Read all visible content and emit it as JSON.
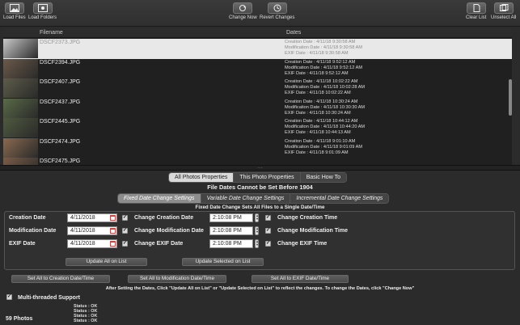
{
  "toolbar": {
    "load_files": "Load Files",
    "load_folders": "Load Folders",
    "change_now": "Change Now",
    "revert_changes": "Revert Changes",
    "clear_list": "Clear List",
    "unselect_all": "Unselect All"
  },
  "table": {
    "col_filename": "Filename",
    "col_dates": "Dates",
    "rows": [
      {
        "filename": "DSCF2373.JPG",
        "creation": "Creation Date : 4/11/18 9:30:58 AM",
        "modification": "Modification Date : 4/11/18 9:30:58 AM",
        "exif": "EXIF Date : 4/11/18 9:30:58 AM",
        "selected": true
      },
      {
        "filename": "DSCF2394.JPG",
        "creation": "Creation Date : 4/11/18 9:52:12 AM",
        "modification": "Modification Date : 4/11/18 9:52:12 AM",
        "exif": "EXIF Date : 4/11/18 9:52:12 AM",
        "selected": false
      },
      {
        "filename": "DSCF2407.JPG",
        "creation": "Creation Date : 4/11/18 10:02:22 AM",
        "modification": "Modification Date : 4/11/18 10:02:28 AM",
        "exif": "EXIF Date : 4/11/18 10:02:22 AM",
        "selected": false
      },
      {
        "filename": "DSCF2437.JPG",
        "creation": "Creation Date : 4/11/18 10:30:24 AM",
        "modification": "Modification Date : 4/11/18 10:30:30 AM",
        "exif": "EXIF Date : 4/11/18 10:30:24 AM",
        "selected": false
      },
      {
        "filename": "DSCF2445.JPG",
        "creation": "Creation Date : 4/11/18 10:44:12 AM",
        "modification": "Modification Date : 4/11/18 10:44:20 AM",
        "exif": "EXIF Date : 4/11/18 10:44:13 AM",
        "selected": false
      },
      {
        "filename": "DSCF2474.JPG",
        "creation": "Creation Date : 4/11/18 9:01:10 AM",
        "modification": "Modification Date : 4/11/18 9:01:09 AM",
        "exif": "EXIF Date : 4/11/18 9:01:09 AM",
        "selected": false
      },
      {
        "filename": "DSCF2475.JPG",
        "creation": "",
        "modification": "",
        "exif": "",
        "selected": false
      }
    ]
  },
  "tabs": [
    "All Photos Properties",
    "This Photo Properties",
    "Basic How To"
  ],
  "tabs_active": 0,
  "warning": "File Dates Cannot be Set Before 1904",
  "subtabs": [
    "Fixed Date Change Settings",
    "Variable Date Change Settings",
    "Incremental Date Change Settings"
  ],
  "subtabs_active": 0,
  "fixed_heading": "Fixed Date Change Sets All Files to a Single Date/Time",
  "fields": {
    "creation_label": "Creation Date",
    "modification_label": "Modification Date",
    "exif_label": "EXIF Date",
    "creation_date": "4/11/2018",
    "modification_date": "4/11/2018",
    "exif_date": "4/11/2018",
    "change_creation_date": "Change Creation Date",
    "change_modification_date": "Change Modification Date",
    "change_exif_date": "Change EXIF Date",
    "creation_time": "2:10:08 PM",
    "modification_time": "2:10:08 PM",
    "exif_time": "2:10:08 PM",
    "change_creation_time": "Change Creation Time",
    "change_modification_time": "Change Modification Time",
    "change_exif_time": "Change EXIF Time",
    "update_all": "Update All on List",
    "update_selected": "Update Selected on List"
  },
  "set_buttons": {
    "creation": "Set All to Creation Date/Time",
    "modification": "Set All to Modification Date/Time",
    "exif": "Set All to EXIF Date/Time"
  },
  "instruction": "After Setting the Dates, Click \"Update All on List\" or \"Update Selected on List\" to reflect the changes. To change the Dates, click \"Change Now\"",
  "multithreaded": "Multi-threaded Support",
  "photo_count": "59 Photos",
  "status_lines": [
    "Status : OK",
    "Status : OK",
    "Status : OK",
    "Status : OK"
  ],
  "colors": {
    "background": "#2b2b2b",
    "selected_row": "#e8e8e8",
    "active_tab": "#d9d9d9"
  }
}
